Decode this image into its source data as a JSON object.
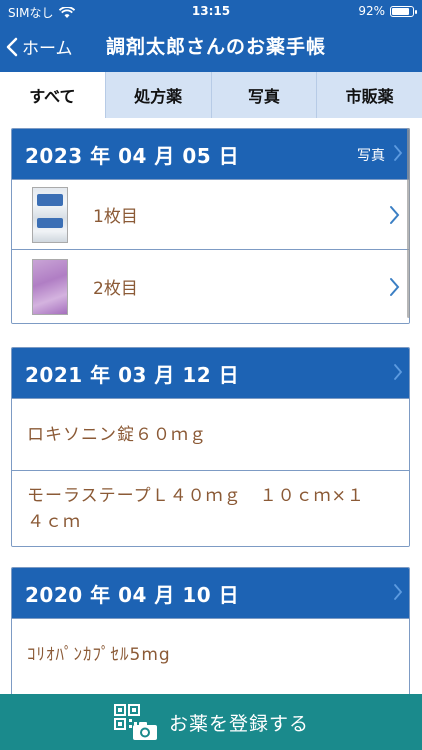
{
  "status": {
    "carrier": "SIMなし",
    "time": "13:15",
    "battery": "92%",
    "battery_level": 0.92
  },
  "nav": {
    "back_label": "ホーム",
    "title": "調剤太郎さんのお薬手帳"
  },
  "tabs": [
    {
      "label": "すべて",
      "active": true
    },
    {
      "label": "処方薬",
      "active": false
    },
    {
      "label": "写真",
      "active": false
    },
    {
      "label": "市販薬",
      "active": false
    }
  ],
  "records": [
    {
      "date": "2023 年 04 月 05 日",
      "photo_link": "写真",
      "rows": [
        {
          "type": "photo",
          "label": "1枚目"
        },
        {
          "type": "photo",
          "label": "2枚目"
        }
      ]
    },
    {
      "date": "2021 年 03 月 12 日",
      "rows": [
        {
          "type": "medicine",
          "label": "ロキソニン錠６０ｍｇ"
        },
        {
          "type": "medicine",
          "label": "モーラステープＬ４０ｍｇ　１０ｃｍ×１４ｃｍ"
        }
      ]
    },
    {
      "date": "2020 年 04 月 10 日",
      "rows": [
        {
          "type": "medicine",
          "label": "ｺﾘｵﾊﾟﾝｶﾌﾟｾﾙ5mg"
        }
      ]
    }
  ],
  "register_button": {
    "label": "お薬を登録する",
    "icon": "qr-camera-icon"
  },
  "colors": {
    "header": "#1d63b4",
    "tab_bg": "#d4e2f4",
    "register": "#1a8a8c",
    "medicine_text": "#8b5a36"
  }
}
